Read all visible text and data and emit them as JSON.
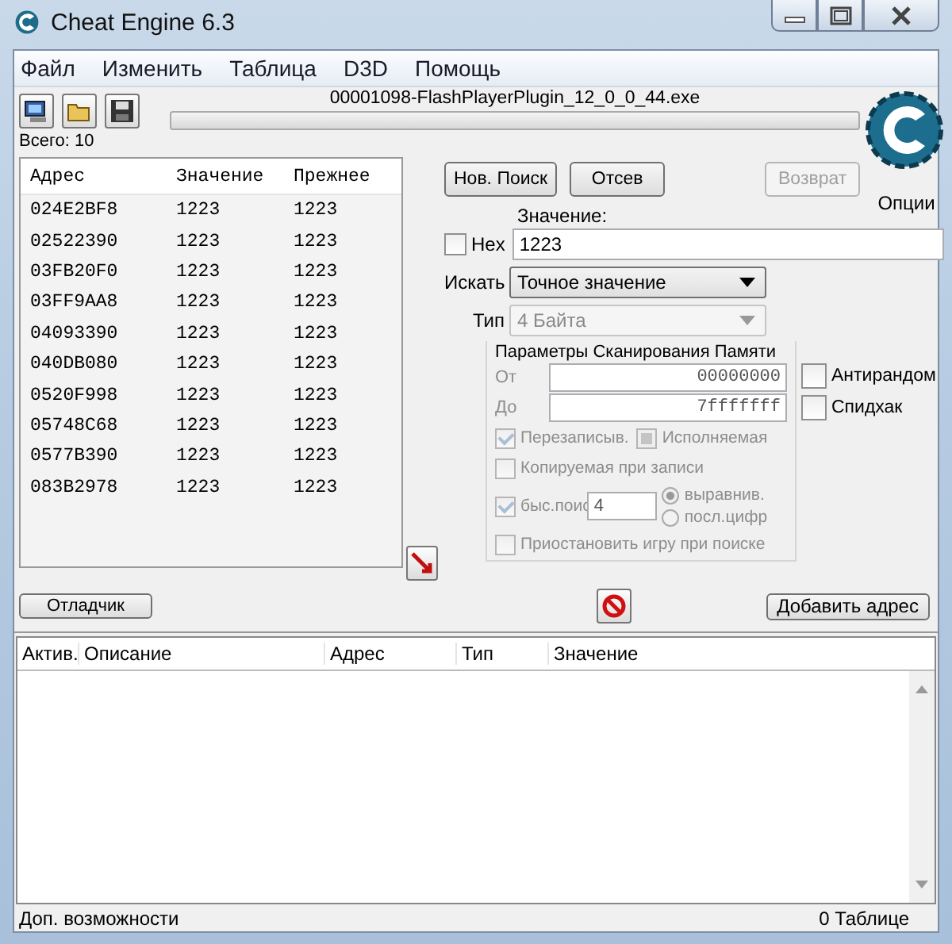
{
  "window": {
    "title": "Cheat Engine 6.3"
  },
  "menu": [
    "Файл",
    "Изменить",
    "Таблица",
    "D3D",
    "Помощь"
  ],
  "process_name": "00001098-FlashPlayerPlugin_12_0_0_44.exe",
  "scan_progress": {
    "level": 0
  },
  "found_count": "Всего: 10",
  "results": {
    "columns": [
      "Адрес",
      "Значение",
      "Прежнее"
    ],
    "rows": [
      [
        "024E2BF8",
        "1223",
        "1223"
      ],
      [
        "02522390",
        "1223",
        "1223"
      ],
      [
        "03FB20F0",
        "1223",
        "1223"
      ],
      [
        "03FF9AA8",
        "1223",
        "1223"
      ],
      [
        "04093390",
        "1223",
        "1223"
      ],
      [
        "040DB080",
        "1223",
        "1223"
      ],
      [
        "0520F998",
        "1223",
        "1223"
      ],
      [
        "05748C68",
        "1223",
        "1223"
      ],
      [
        "0577B390",
        "1223",
        "1223"
      ],
      [
        "083B2978",
        "1223",
        "1223"
      ]
    ]
  },
  "scan_buttons": [
    {
      "label": "Нов. Поиск",
      "disabled": false
    },
    {
      "label": "Отсев",
      "disabled": false
    },
    {
      "label": "Возврат",
      "disabled": true
    }
  ],
  "settings_label": "Опции",
  "value": {
    "label": "Значение:",
    "hex_label": "Hex",
    "hex_checked": false,
    "text": "1223"
  },
  "scan_type": {
    "label": "Искать",
    "value": "Точное значение",
    "disabled": false
  },
  "value_type": {
    "label": "Тип",
    "value": "4 Байта",
    "disabled": true
  },
  "memory_options": {
    "title": "Параметры Сканирования Памяти",
    "disabled": true,
    "from": {
      "label": "От",
      "value": "00000000"
    },
    "to": {
      "label": "До",
      "value": "7fffffff"
    },
    "writable": {
      "label": "Перезаписыв.",
      "checked": true
    },
    "executable": {
      "label": "Исполняемая",
      "checked": false,
      "indeterminate": true
    },
    "copy_on_write": {
      "label": "Копируемая при записи",
      "checked": false
    },
    "fast_scan": {
      "label": "быс.поис",
      "checked": true,
      "value": "4"
    },
    "alignment": [
      {
        "label": "выравнив.",
        "selected": true
      },
      {
        "label": "посл.цифр",
        "selected": false
      }
    ],
    "pause_game": {
      "label": "Приостановить игру при поиске",
      "checked": false
    }
  },
  "side_options": [
    {
      "label": "Антирандом",
      "checked": false
    },
    {
      "label": "Спидхак",
      "checked": false
    }
  ],
  "debugger_button": "Отладчик",
  "add_address_button": "Добавить адрес",
  "address_list": {
    "columns": [
      "Актив.",
      "Описание",
      "Адрес",
      "Тип",
      "Значение"
    ]
  },
  "status_bar": {
    "left": "Доп. возможности",
    "right": "0 Таблице"
  }
}
